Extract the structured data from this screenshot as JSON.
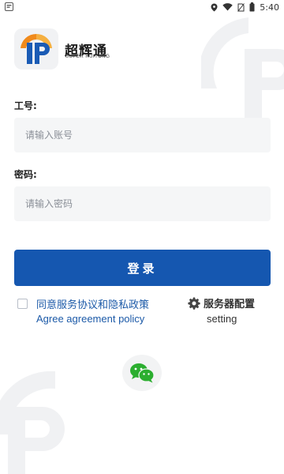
{
  "status_bar": {
    "time": "5:40",
    "icons": [
      "notification-icon",
      "location-icon",
      "wifi-icon",
      "no-sim-icon",
      "battery-icon"
    ]
  },
  "brand": {
    "name_cn": "超辉通",
    "name_en": "SUPER HUITONG",
    "colors": {
      "orange": "#f08a1c",
      "blue": "#1a5bb5"
    }
  },
  "form": {
    "account_label": "工号:",
    "account_placeholder": "请输入账号",
    "password_label": "密码:",
    "password_placeholder": "请输入密码"
  },
  "actions": {
    "login_label": "登录",
    "login_color": "#1557b0",
    "agreement_cn": "同意服务协议和隐私政策",
    "agreement_en": "Agree agreement policy",
    "agreement_checked": false,
    "server_config_cn": "服务器配置",
    "server_config_en": "setting"
  },
  "social": {
    "wechat_icon": "wechat-icon",
    "wechat_color": "#2bae2f"
  }
}
